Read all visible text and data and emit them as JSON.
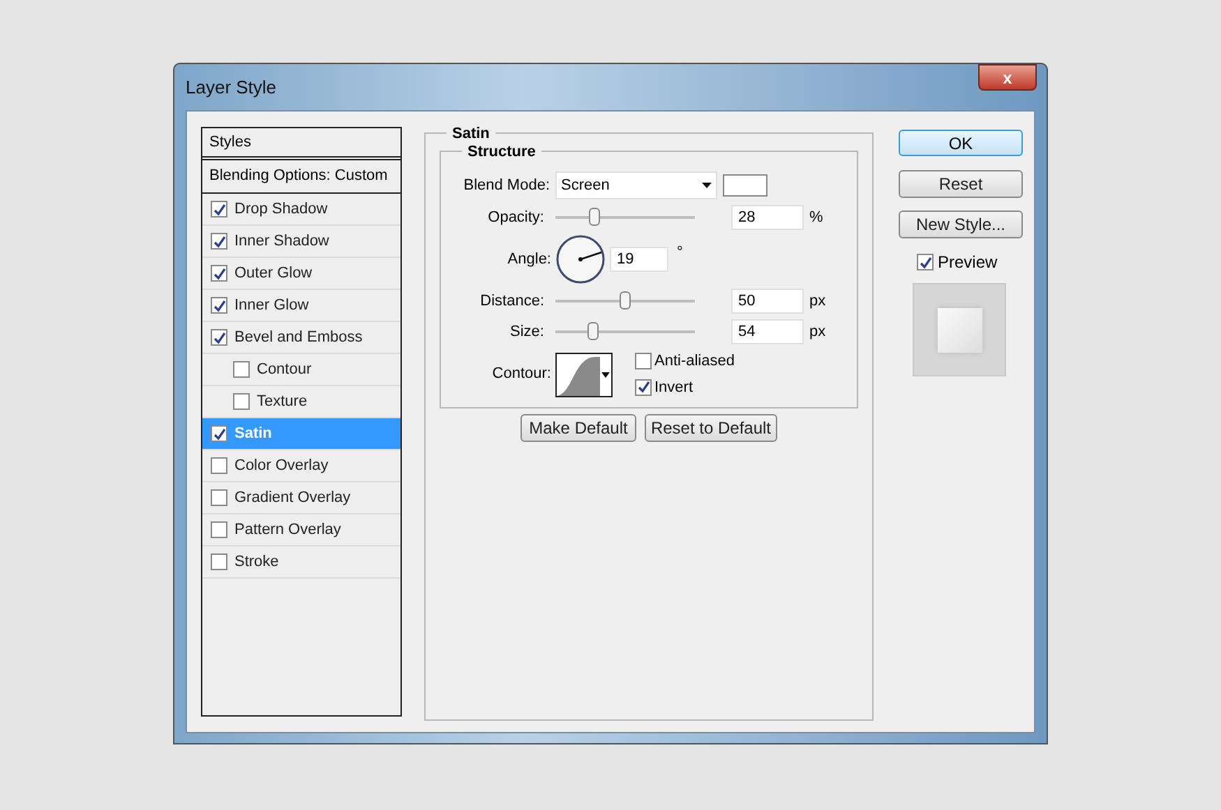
{
  "window": {
    "title": "Layer Style",
    "close": "x"
  },
  "sidebar": {
    "header": "Styles",
    "blending": "Blending Options: Custom",
    "items": [
      {
        "label": "Drop Shadow",
        "checked": true,
        "selected": false
      },
      {
        "label": "Inner Shadow",
        "checked": true,
        "selected": false
      },
      {
        "label": "Outer Glow",
        "checked": true,
        "selected": false
      },
      {
        "label": "Inner Glow",
        "checked": true,
        "selected": false
      },
      {
        "label": "Bevel and Emboss",
        "checked": true,
        "selected": false,
        "children": [
          {
            "label": "Contour",
            "checked": false,
            "selected": false
          },
          {
            "label": "Texture",
            "checked": false,
            "selected": false
          }
        ]
      },
      {
        "label": "Satin",
        "checked": true,
        "selected": true
      },
      {
        "label": "Color Overlay",
        "checked": false,
        "selected": false
      },
      {
        "label": "Gradient Overlay",
        "checked": false,
        "selected": false
      },
      {
        "label": "Pattern Overlay",
        "checked": false,
        "selected": false
      },
      {
        "label": "Stroke",
        "checked": false,
        "selected": false
      }
    ]
  },
  "panel": {
    "title": "Satin",
    "group": "Structure",
    "blend_mode": {
      "label": "Blend Mode:",
      "value": "Screen"
    },
    "opacity": {
      "label": "Opacity:",
      "level": 0.28,
      "value": "28",
      "unit": "%"
    },
    "angle": {
      "label": "Angle:",
      "value": "19",
      "unit": "°"
    },
    "distance": {
      "label": "Distance:",
      "level": 0.5,
      "value": "50",
      "unit": "px"
    },
    "size": {
      "label": "Size:",
      "level": 0.27,
      "value": "54",
      "unit": "px"
    },
    "contour": {
      "label": "Contour:"
    },
    "anti_aliased": {
      "label": "Anti-aliased",
      "checked": false
    },
    "invert": {
      "label": "Invert",
      "checked": true
    },
    "buttons": [
      "Make Default",
      "Reset to Default"
    ]
  },
  "actions": {
    "buttons": [
      "OK",
      "Reset",
      "New Style..."
    ],
    "preview": {
      "label": "Preview",
      "checked": true
    }
  }
}
